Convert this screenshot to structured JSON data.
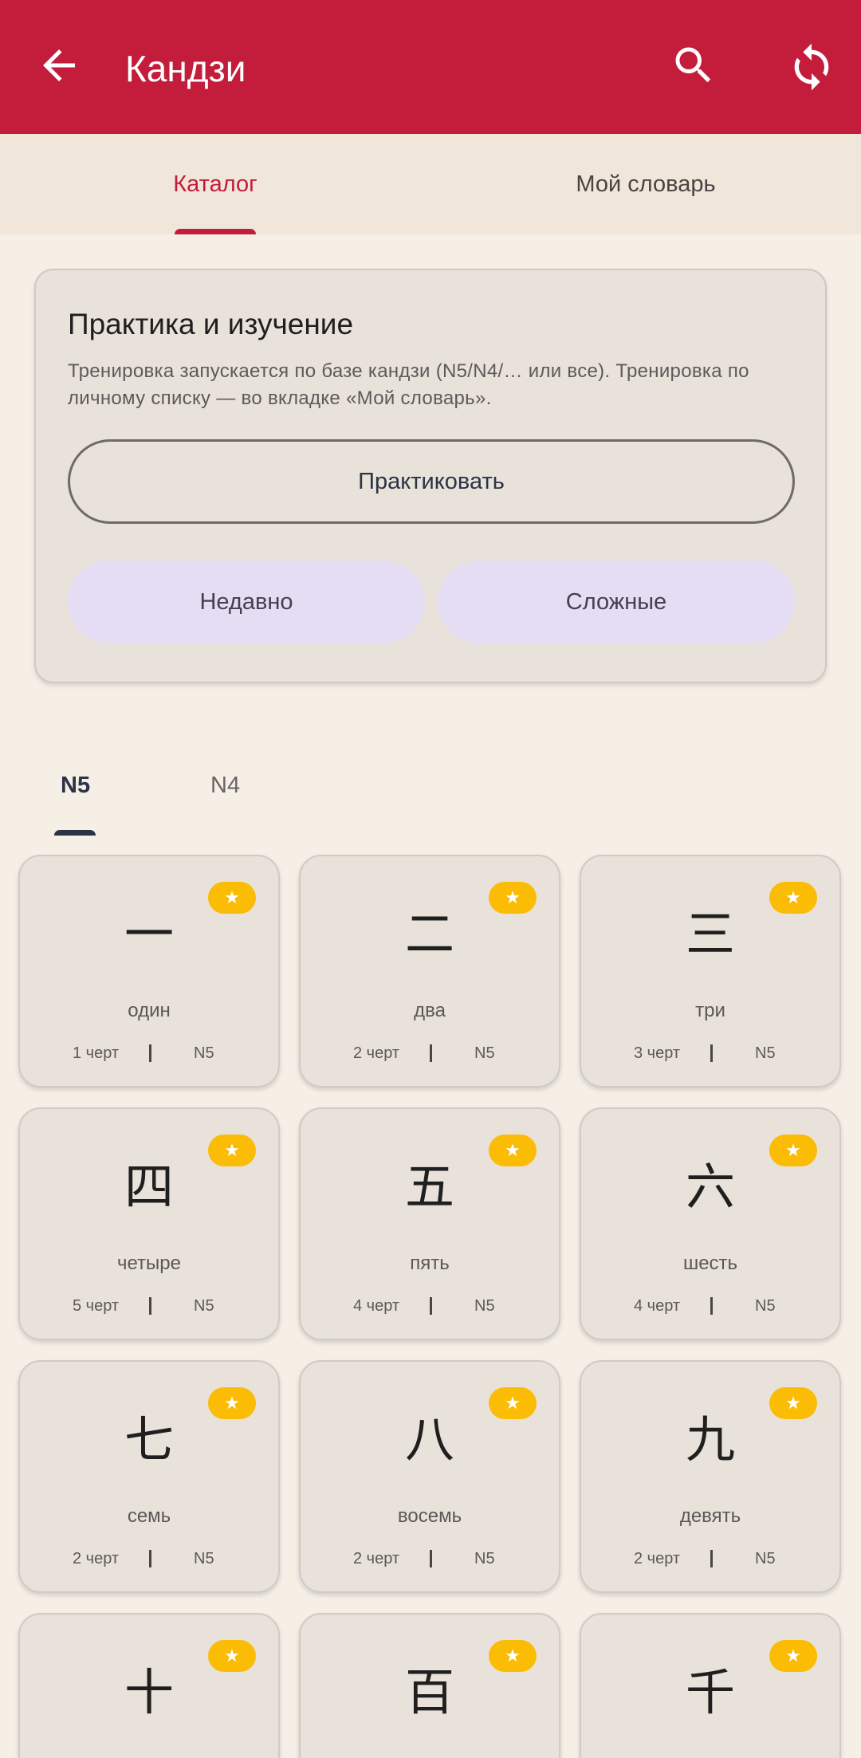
{
  "appbar": {
    "title": "Кандзи",
    "icons": {
      "back": "arrow-back-icon",
      "search": "search-icon",
      "sync": "sync-icon"
    },
    "color": "#c41c3b"
  },
  "tabs": {
    "catalog": "Каталог",
    "my_dictionary": "Мой словарь",
    "selected": "Каталог"
  },
  "practice": {
    "title": "Практика и изучение",
    "description": "Тренировка запускается по базе кандзи (N5/N4/… или все). Тренировка по личному списку — во вкладке «Мой словарь».",
    "practice_button": "Практиковать",
    "recent_button": "Недавно",
    "hard_button": "Сложные"
  },
  "levels": {
    "items": [
      "N5",
      "N4"
    ],
    "selected": "N5"
  },
  "kanji": [
    {
      "glyph": "一",
      "meaning": "один",
      "strokes": "1 черт",
      "level": "N5",
      "badge": "★"
    },
    {
      "glyph": "二",
      "meaning": "два",
      "strokes": "2 черт",
      "level": "N5",
      "badge": "★"
    },
    {
      "glyph": "三",
      "meaning": "три",
      "strokes": "3 черт",
      "level": "N5",
      "badge": "★"
    },
    {
      "glyph": "四",
      "meaning": "четыре",
      "strokes": "5 черт",
      "level": "N5",
      "badge": "★"
    },
    {
      "glyph": "五",
      "meaning": "пять",
      "strokes": "4 черт",
      "level": "N5",
      "badge": "★"
    },
    {
      "glyph": "六",
      "meaning": "шесть",
      "strokes": "4 черт",
      "level": "N5",
      "badge": "★"
    },
    {
      "glyph": "七",
      "meaning": "семь",
      "strokes": "2 черт",
      "level": "N5",
      "badge": "★"
    },
    {
      "glyph": "八",
      "meaning": "восемь",
      "strokes": "2 черт",
      "level": "N5",
      "badge": "★"
    },
    {
      "glyph": "九",
      "meaning": "девять",
      "strokes": "2 черт",
      "level": "N5",
      "badge": "★"
    },
    {
      "glyph": "十",
      "meaning": "",
      "strokes": "",
      "level": "",
      "badge": "★"
    },
    {
      "glyph": "百",
      "meaning": "",
      "strokes": "",
      "level": "",
      "badge": "★"
    },
    {
      "glyph": "千",
      "meaning": "",
      "strokes": "",
      "level": "",
      "badge": "★"
    }
  ]
}
